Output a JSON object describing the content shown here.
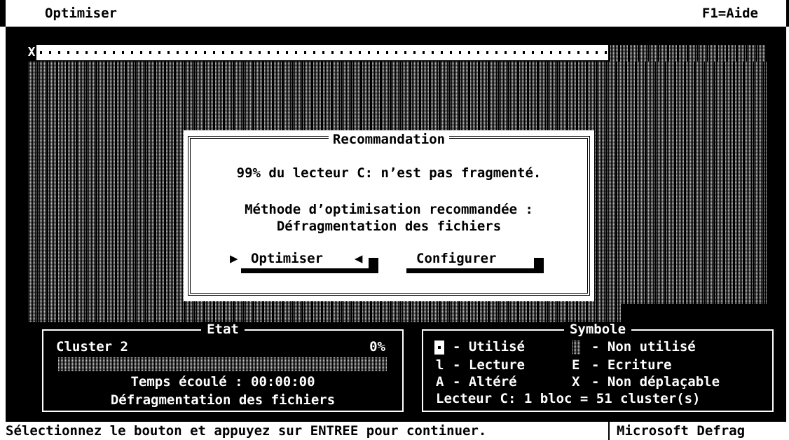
{
  "app": {
    "title": "Optimiser",
    "help": "F1=Aide"
  },
  "map": {
    "unmovable_marker": "X"
  },
  "dialog": {
    "title": "Recommandation",
    "line1": "99% du lecteur C: n’est pas fragmenté.",
    "line2": "Méthode d’optimisation recommandée :",
    "line3": "Défragmentation des fichiers",
    "btn_optimise": "Optimiser",
    "btn_configure": "Configurer"
  },
  "state": {
    "title": "Etat",
    "cluster": "Cluster 2",
    "percent": "0%",
    "progress": 0,
    "elapsed": "Temps écoulé : 00:00:00",
    "method": "Défragmentation des fichiers"
  },
  "legend": {
    "title": "Symbole",
    "used": "- Utilisé",
    "unused": "- Non utilisé",
    "read_sym": "l",
    "read": "- Lecture",
    "write_sym": "E",
    "write": "- Ecriture",
    "bad_sym": "A",
    "bad": "- Altéré",
    "fixed_sym": "X",
    "fixed": "- Non déplaçable",
    "block": "Lecteur C: 1 bloc = 51 cluster(s)"
  },
  "statusbar": {
    "message": "Sélectionnez le bouton et appuyez sur ENTREE pour continuer.",
    "app": "Microsoft Defrag"
  }
}
